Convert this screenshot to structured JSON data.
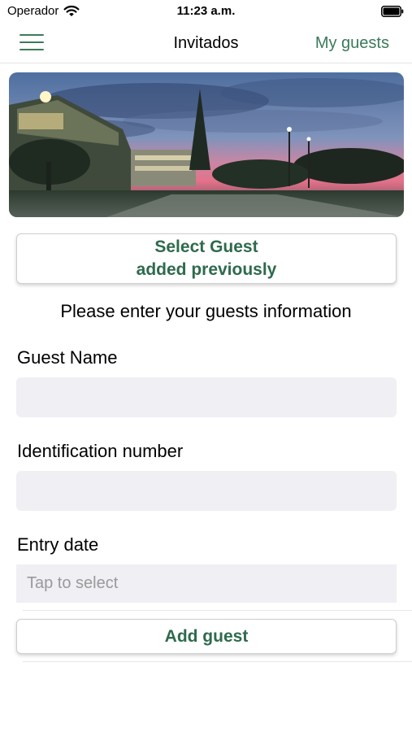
{
  "status_bar": {
    "carrier": "Operador",
    "time": "11:23 a.m."
  },
  "nav": {
    "title": "Invitados",
    "right_link": "My guests",
    "menu_icon": "hamburger-menu-icon"
  },
  "hero": {
    "image_alt": "campus-at-dusk-photo"
  },
  "select_guest": {
    "line1": "Select Guest",
    "line2": "added previously"
  },
  "instructions": "Please enter your guests information",
  "form": {
    "guest_name": {
      "label": "Guest Name",
      "value": ""
    },
    "identification": {
      "label": "Identification number",
      "value": ""
    },
    "entry_date": {
      "label": "Entry date",
      "placeholder": "Tap to select"
    }
  },
  "add_button": "Add guest",
  "colors": {
    "accent": "#2e6a4d",
    "input_bg": "#efeff4"
  }
}
